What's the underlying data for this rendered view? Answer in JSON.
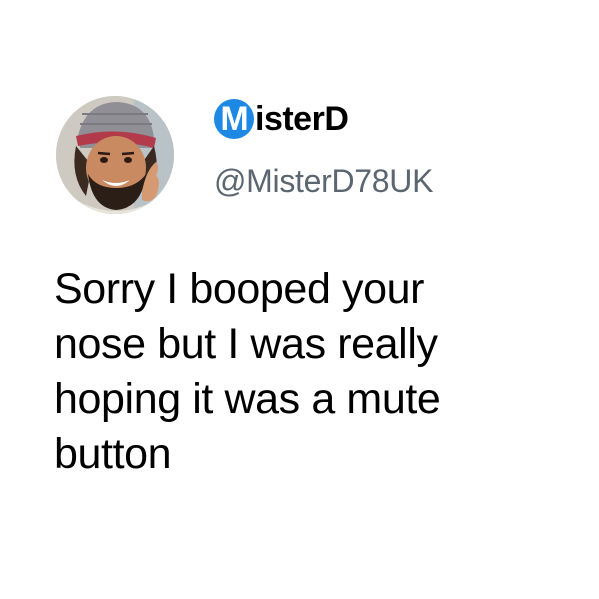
{
  "author": {
    "name_badge_letter": "M",
    "name_rest": "isterD",
    "handle": "@MisterD78UK",
    "badge_color": "#1e88e5",
    "handle_color": "#5b6670"
  },
  "tweet": {
    "lines": [
      "Sorry I booped your",
      "nose but I was really",
      "hoping it was a mute",
      "button"
    ]
  }
}
